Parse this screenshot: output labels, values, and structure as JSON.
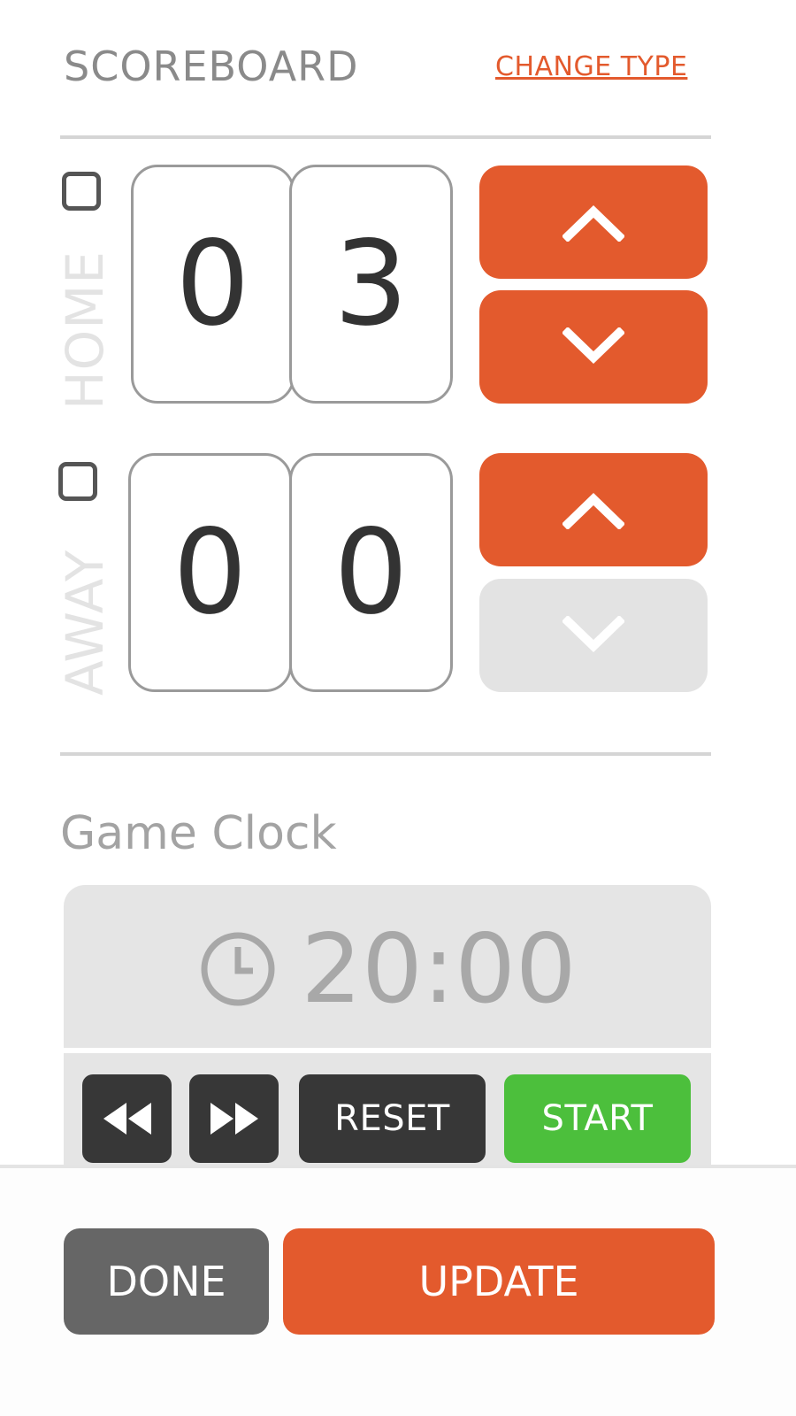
{
  "header": {
    "title": "SCOREBOARD",
    "change_type_label": "CHANGE TYPE"
  },
  "teams": [
    {
      "label": "HOME",
      "digits": [
        "0",
        "3"
      ],
      "up_enabled": true,
      "down_enabled": true
    },
    {
      "label": "AWAY",
      "digits": [
        "0",
        "0"
      ],
      "up_enabled": true,
      "down_enabled": false
    }
  ],
  "game_clock": {
    "title": "Game Clock",
    "time": "20:00",
    "controls": {
      "reset_label": "RESET",
      "start_label": "START"
    }
  },
  "footer": {
    "done_label": "DONE",
    "update_label": "UPDATE"
  },
  "colors": {
    "accent": "#e35a2d",
    "start_green": "#4cbf3c",
    "dark_button": "#373737",
    "done_gray": "#666666",
    "disabled": "#e3e3e3"
  },
  "icons": {
    "up": "chevron-up-icon",
    "down": "chevron-down-icon",
    "clock": "clock-icon",
    "rewind": "rewind-icon",
    "fast_forward": "fast-forward-icon"
  }
}
